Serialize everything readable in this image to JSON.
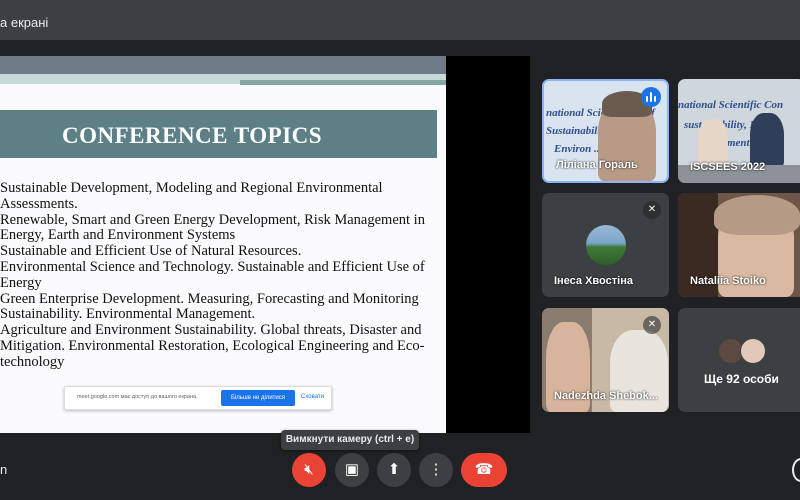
{
  "topbar": {
    "label": "а екрані"
  },
  "slide": {
    "title": "CONFERENCE TOPICS",
    "topics": [
      "Sustainable Development, Modeling and Regional Environmental Assessments.",
      "Renewable, Smart and Green Energy Development, Risk Management in Energy, Earth and Environment Systems",
      "Sustainable and Efficient Use of Natural Resources.",
      "Environmental Science and Technology. Sustainable and Efficient Use of Energy",
      "Green Enterprise Development. Measuring, Forecasting and Monitoring Sustainability. Environmental Management.",
      "Agriculture and Environment  Sustainability. Global threats, Disaster and Mitigation. Environmental Restoration, Ecological Engineering and Eco-technology"
    ],
    "share_bar": {
      "message": "meet.google.com має доступ до вашого екрана.",
      "stop_label": "Більше не ділитися",
      "hide_label": "Сховати"
    }
  },
  "participants": [
    {
      "name": "Ліліана Гораль",
      "bg_text": [
        "national Scientific Conf",
        "Sustainability Energy",
        "Environ ..."
      ]
    },
    {
      "name": "ISCSEES 2022",
      "bg_text": [
        "national Scientific Con",
        "sustainability, Ene",
        "ironment"
      ]
    },
    {
      "name": "Інеса Хвостіна",
      "muted_icon": "mic-off-icon"
    },
    {
      "name": "Nataliia Stoiko"
    },
    {
      "name": "Nadezhda Shebok...",
      "muted_icon": "mic-off-icon"
    },
    {
      "name": "Ще 92 особи"
    }
  ],
  "controls": {
    "tooltip": "Вимкнути камеру (ctrl + e)",
    "mic_icon": "mic-off-icon",
    "camera_icon": "camera-icon",
    "present_icon": "present-screen-icon",
    "more_icon": "more-vert-icon",
    "hangup_icon": "hangup-icon"
  },
  "bottom_left": "n",
  "colors": {
    "accent": "#1a73e8",
    "danger": "#ea4335",
    "banner": "#5d7f86"
  }
}
